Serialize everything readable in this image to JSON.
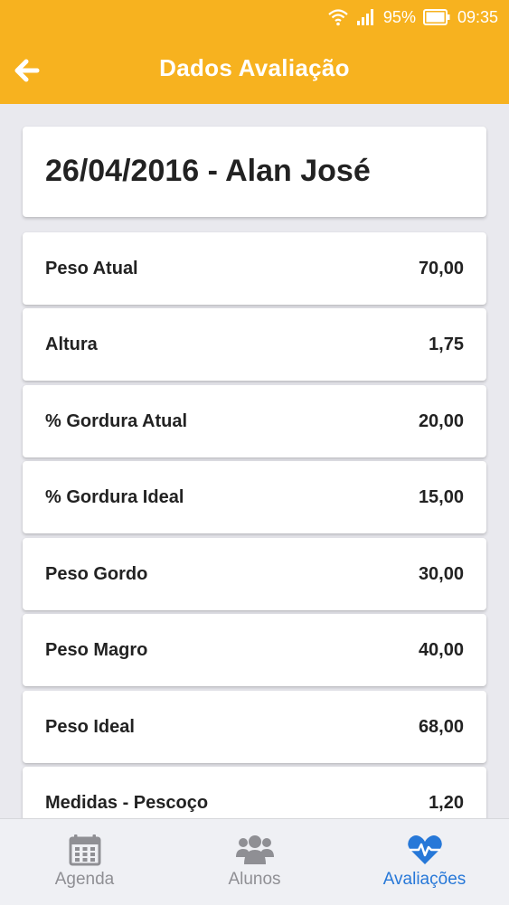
{
  "status_bar": {
    "battery": "95%",
    "time": "09:35"
  },
  "header": {
    "title": "Dados Avaliação"
  },
  "evaluation": {
    "date_name": "26/04/2016 - Alan José",
    "rows": [
      {
        "label": "Peso Atual",
        "value": "70,00"
      },
      {
        "label": "Altura",
        "value": "1,75"
      },
      {
        "label": "% Gordura Atual",
        "value": "20,00"
      },
      {
        "label": "% Gordura Ideal",
        "value": "15,00"
      },
      {
        "label": "Peso Gordo",
        "value": "30,00"
      },
      {
        "label": "Peso Magro",
        "value": "40,00"
      },
      {
        "label": "Peso Ideal",
        "value": "68,00"
      },
      {
        "label": "Medidas - Pescoço",
        "value": "1,20"
      }
    ]
  },
  "tabs": [
    {
      "label": "Agenda",
      "icon": "calendar-icon",
      "active": false
    },
    {
      "label": "Alunos",
      "icon": "users-icon",
      "active": false
    },
    {
      "label": "Avaliações",
      "icon": "heart-pulse-icon",
      "active": true
    }
  ],
  "colors": {
    "header_bg": "#f7b21f",
    "page_bg": "#e9e9ee",
    "active_tab": "#2778d8",
    "inactive_tab": "#8f8f94"
  }
}
